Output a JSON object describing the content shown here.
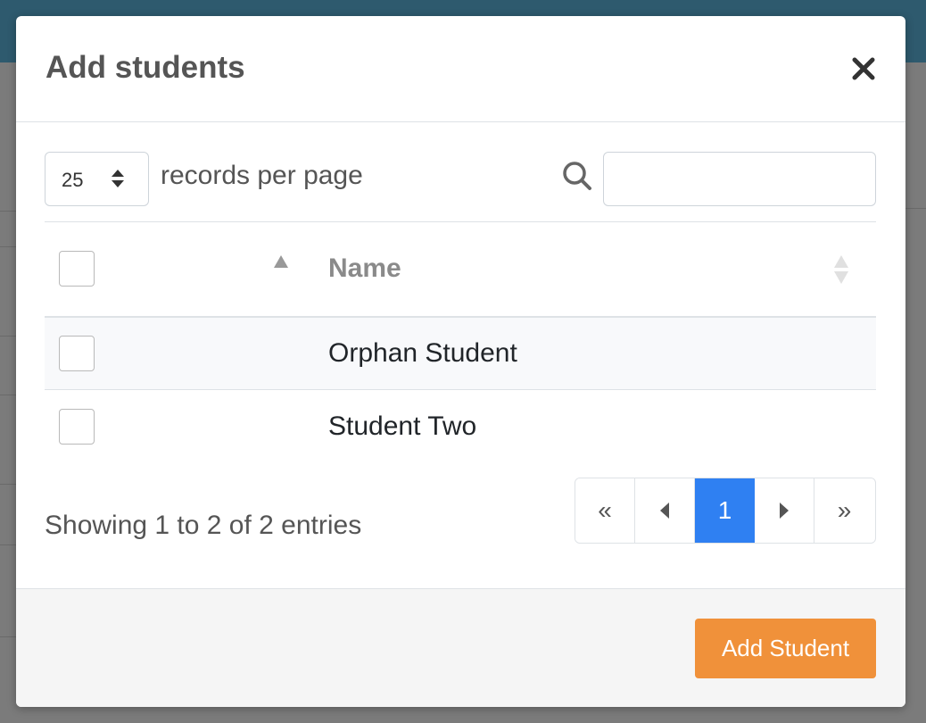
{
  "modal": {
    "title": "Add students",
    "close_icon": "close-icon"
  },
  "toolbar": {
    "page_length": "25",
    "records_label": "records per page",
    "search_value": "",
    "search_placeholder": ""
  },
  "table": {
    "columns": [
      "",
      "Name"
    ],
    "rows": [
      {
        "name": "Orphan Student"
      },
      {
        "name": "Student Two"
      }
    ]
  },
  "info": "Showing 1 to 2 of 2 entries",
  "pagination": {
    "first": "«",
    "prev": "◀",
    "current": "1",
    "next": "▶",
    "last": "»"
  },
  "footer": {
    "add_button": "Add Student"
  },
  "colors": {
    "accent": "#2f80f2",
    "add_button": "#f0913a",
    "header_bar": "#2e5a6e"
  }
}
